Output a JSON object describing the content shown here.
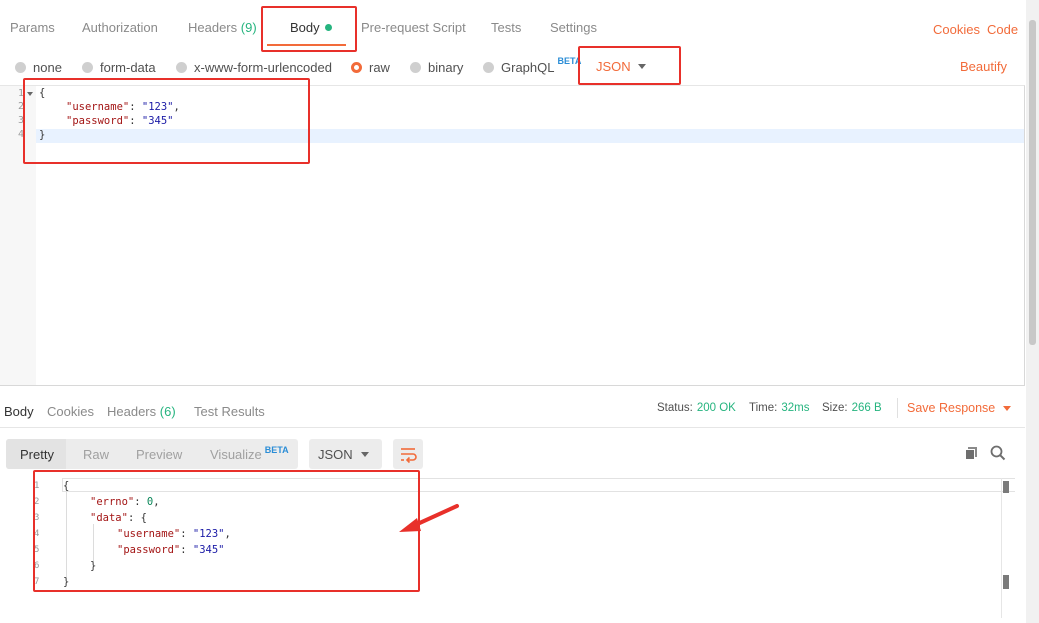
{
  "request_tabs": {
    "params": "Params",
    "authorization": "Authorization",
    "headers": "Headers",
    "headers_count": "(9)",
    "body": "Body",
    "pre_request": "Pre-request Script",
    "tests": "Tests",
    "settings": "Settings",
    "cookies": "Cookies",
    "code": "Code"
  },
  "body_types": {
    "none": "none",
    "form_data": "form-data",
    "urlencoded": "x-www-form-urlencoded",
    "raw": "raw",
    "binary": "binary",
    "graphql": "GraphQL",
    "graphql_badge": "BETA",
    "format": "JSON",
    "beautify": "Beautify"
  },
  "request_editor": {
    "line_numbers": [
      "1",
      "2",
      "3",
      "4"
    ],
    "open_brace": "{",
    "close_brace": "}",
    "username_key": "\"username\"",
    "username_val": "\"123\"",
    "password_key": "\"password\"",
    "password_val": "\"345\""
  },
  "response": {
    "tabs": {
      "body": "Body",
      "cookies": "Cookies",
      "headers": "Headers",
      "headers_count": "(6)",
      "test_results": "Test Results"
    },
    "status_label": "Status:",
    "status_value": "200 OK",
    "time_label": "Time:",
    "time_value": "32ms",
    "size_label": "Size:",
    "size_value": "266 B",
    "save_response": "Save Response",
    "views": {
      "pretty": "Pretty",
      "raw": "Raw",
      "preview": "Preview",
      "visualize": "Visualize",
      "visualize_badge": "BETA"
    },
    "format": "JSON",
    "line_numbers": [
      "1",
      "2",
      "3",
      "4",
      "5",
      "6",
      "7"
    ],
    "open_brace": "{",
    "close_brace": "}",
    "errno_key": "\"errno\"",
    "errno_val": "0",
    "data_key": "\"data\"",
    "data_open": "{",
    "data_close": "}",
    "username_key": "\"username\"",
    "username_val": "\"123\"",
    "password_key": "\"password\"",
    "password_val": "\"345\""
  },
  "colors": {
    "accent": "#f26b3a",
    "success": "#26b47f",
    "annotation": "#e8302a"
  }
}
